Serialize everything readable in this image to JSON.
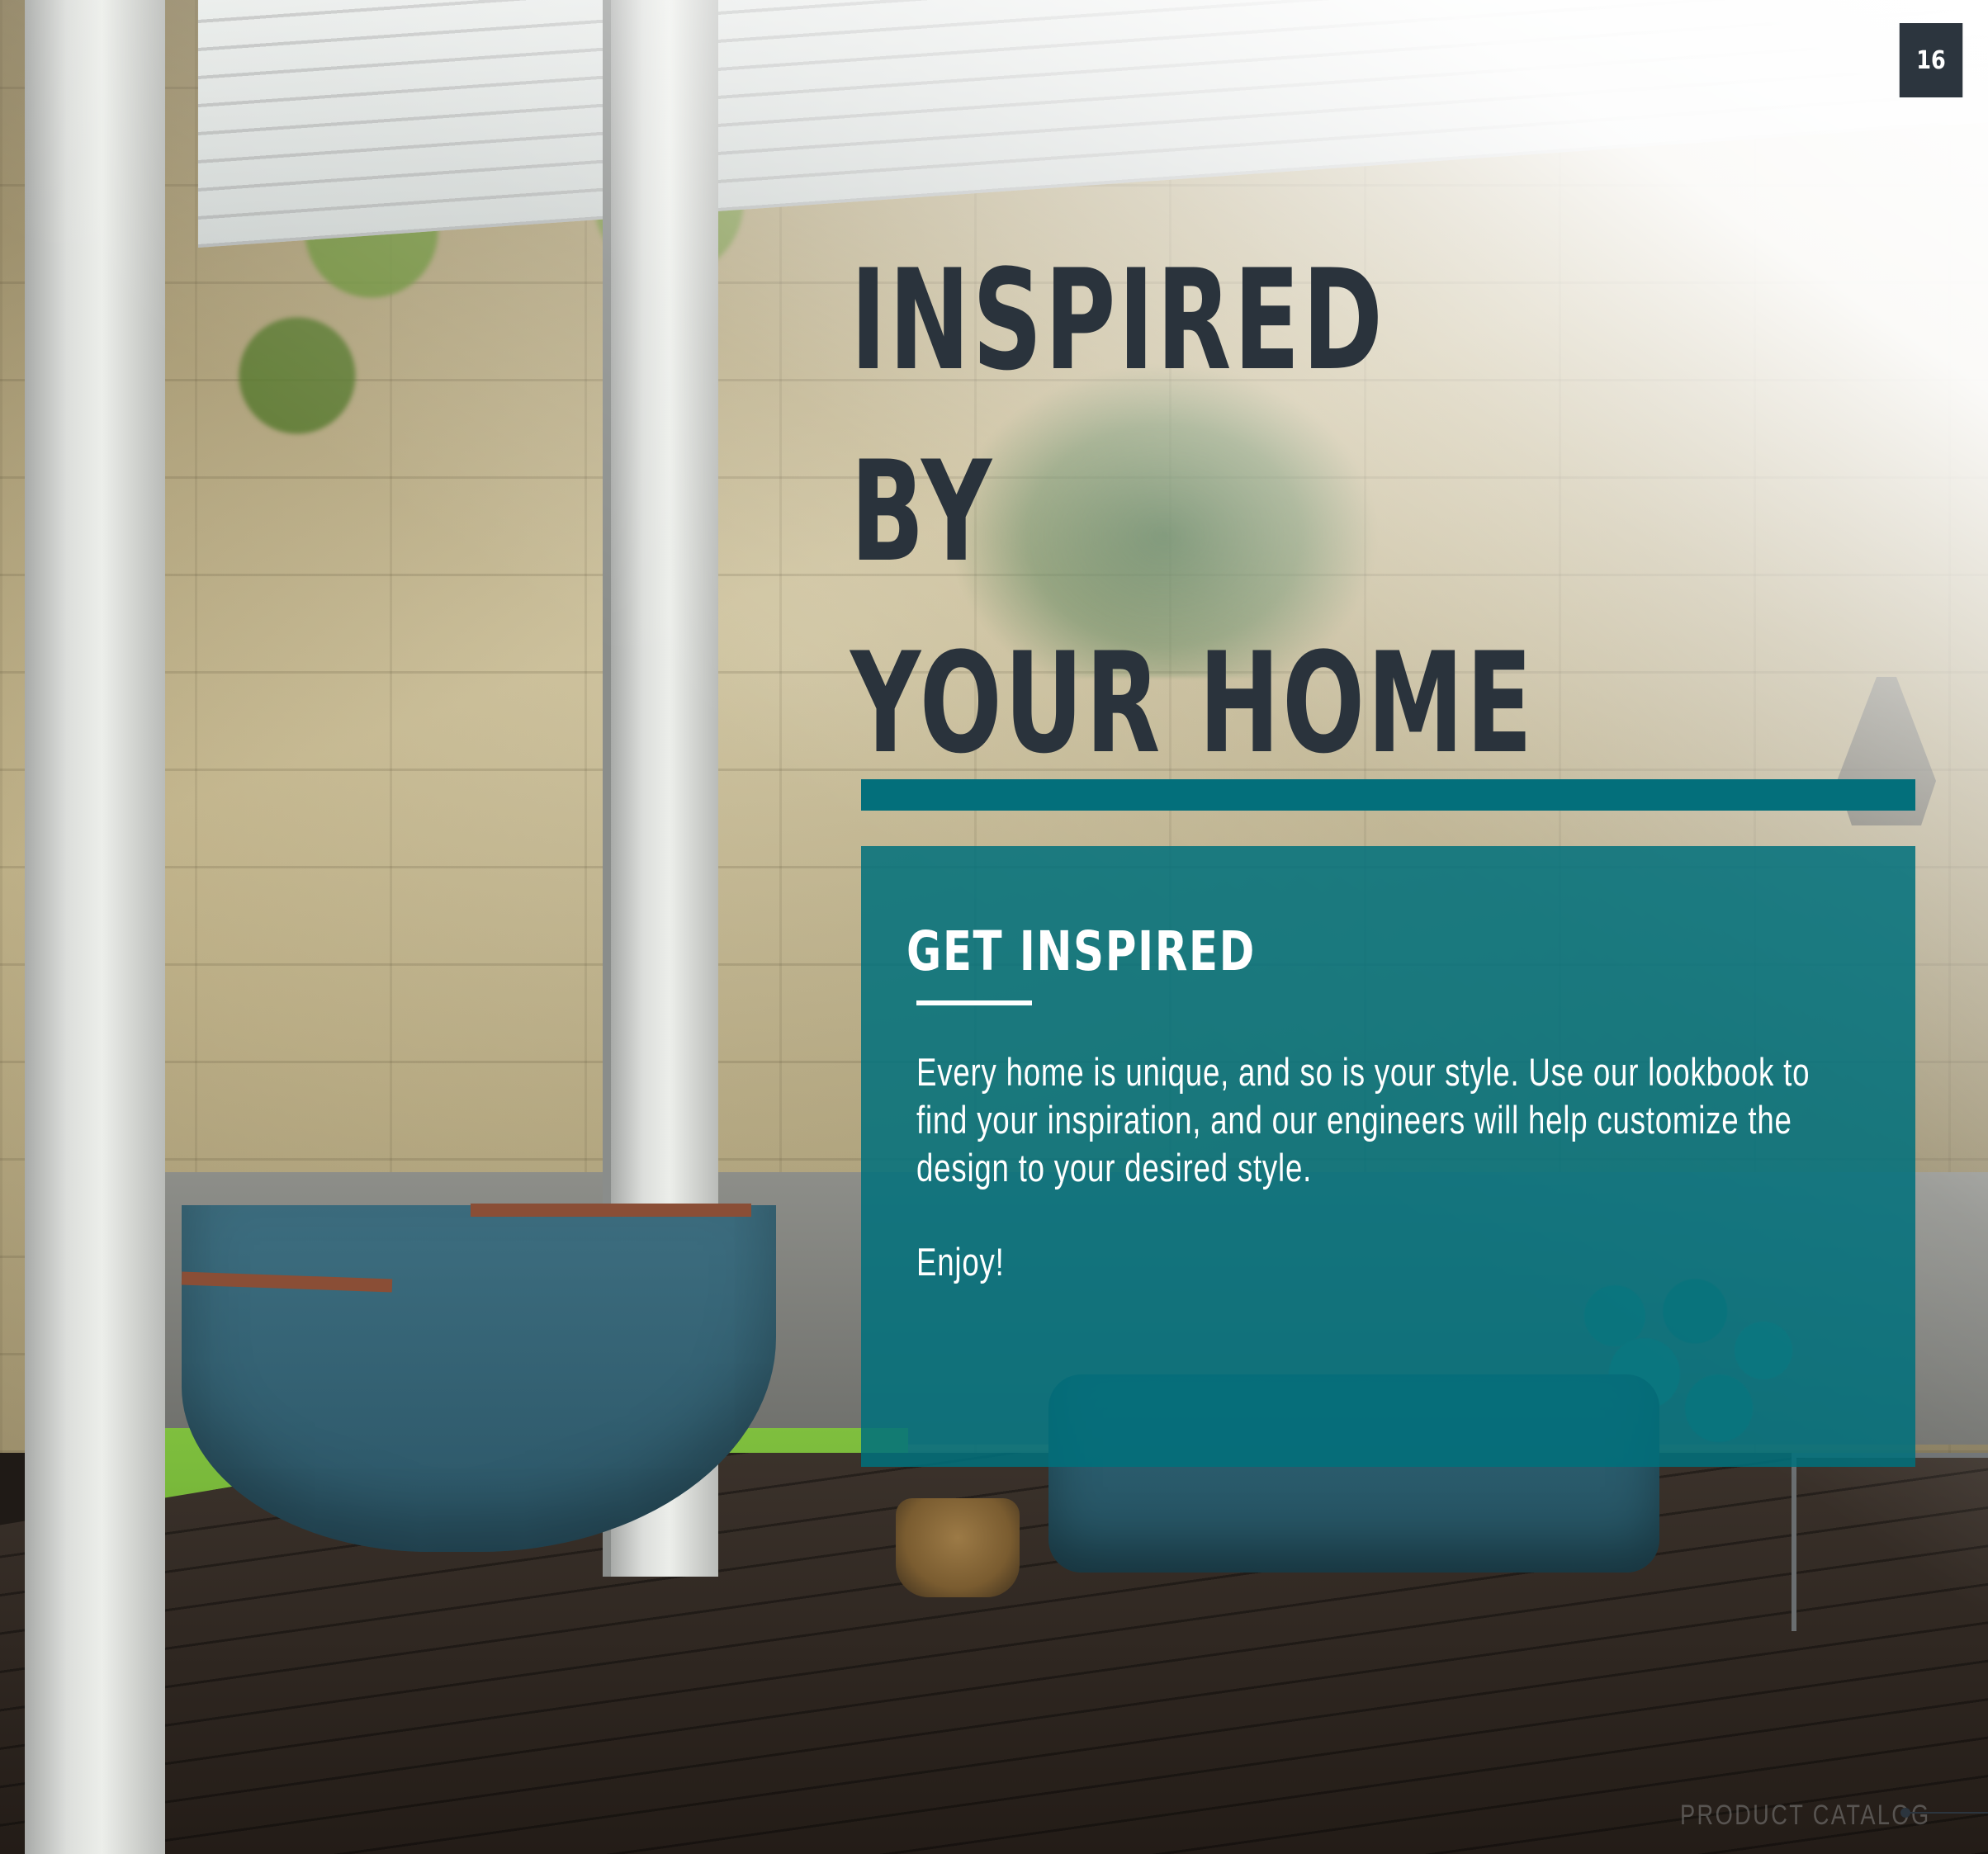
{
  "page": {
    "number": "16"
  },
  "headline": {
    "lines": [
      "INSPIRED",
      "BY",
      "YOUR HOME"
    ]
  },
  "panel": {
    "heading": "GET INSPIRED",
    "body": "Every home is unique, and so is your style. Use our lookbook to find your inspiration, and our engineers will help customize the design to your desired style.",
    "closing": "Enjoy!"
  },
  "footer": {
    "label": "PRODUCT CATALOG"
  },
  "colors": {
    "accent_teal": "#036f7b",
    "panel_teal": "#00707c",
    "dark_slate": "#2c353e",
    "headline_text": "#2a333c"
  }
}
